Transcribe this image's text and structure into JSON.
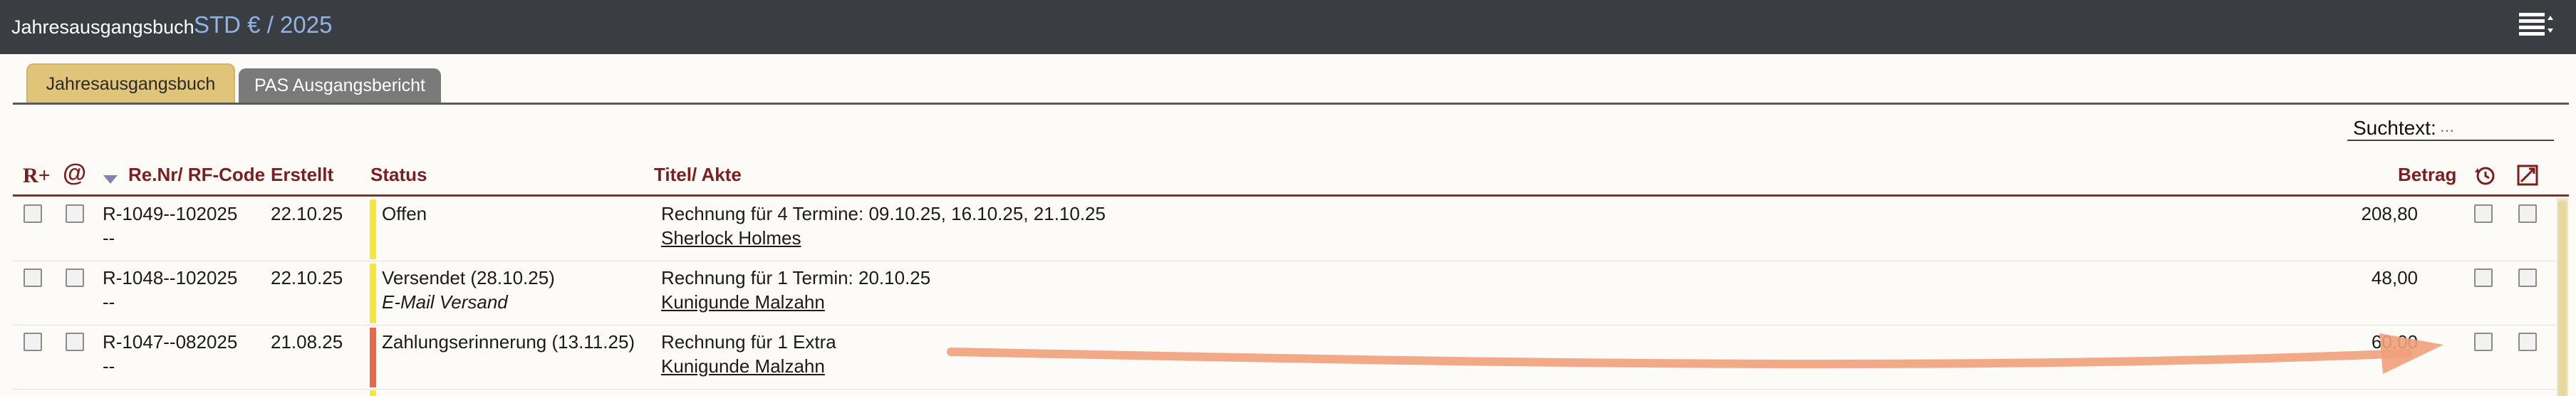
{
  "header": {
    "title": "Jahresausgangsbuch",
    "subtitle": "STD € / 2025",
    "menu_icon": "list-menu-icon"
  },
  "tabs": [
    {
      "label": "Jahresausgangsbuch",
      "active": true
    },
    {
      "label": "PAS Ausgangsbericht",
      "active": false
    }
  ],
  "search": {
    "label": "Suchtext:",
    "placeholder": "..."
  },
  "table": {
    "columns": {
      "new_invoice_icon": "R+",
      "email_icon": "@",
      "sort_icon": "sort-down-icon",
      "renr": "Re.Nr/ RF-Code",
      "created": "Erstellt",
      "status": "Status",
      "title": "Titel/ Akte",
      "amount": "Betrag",
      "history_icon": "history-icon",
      "pdf_icon": "document-edit-icon"
    },
    "rows": [
      {
        "renr": "R-1049--102025",
        "renr_sub": "--",
        "created": "22.10.25",
        "status": "Offen",
        "status_sub": "",
        "status_color": "#f5e63a",
        "title": "Rechnung für 4 Termine: 09.10.25, 16.10.25, 21.10.25",
        "client": "Sherlock Holmes",
        "amount": "208,80"
      },
      {
        "renr": "R-1048--102025",
        "renr_sub": "--",
        "created": "22.10.25",
        "status": "Versendet (28.10.25)",
        "status_sub": "E-Mail Versand",
        "status_color": "#f5e63a",
        "title": "Rechnung für 1 Termin: 20.10.25",
        "client": "Kunigunde Malzahn",
        "amount": "48,00"
      },
      {
        "renr": "R-1047--082025",
        "renr_sub": "--",
        "created": "21.08.25",
        "status": "Zahlungserinnerung (13.11.25)",
        "status_sub": "",
        "status_color": "#e8684a",
        "title": "Rechnung für 1 Extra",
        "client": "Kunigunde Malzahn",
        "amount": "60,00"
      }
    ]
  },
  "colors": {
    "header_bg": "#3a3d41",
    "accent_blue": "#8fb4e6",
    "active_tab": "#e0c479",
    "column_header": "#7a1f1f",
    "annotation_arrow": "#f0a07a"
  }
}
